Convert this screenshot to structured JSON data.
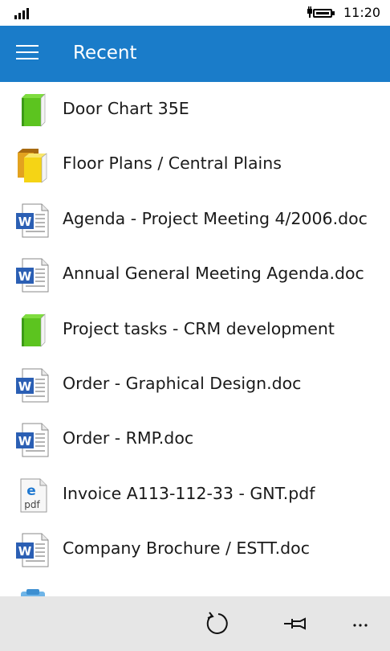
{
  "status": {
    "time": "11:20"
  },
  "header": {
    "title": "Recent"
  },
  "items": [
    {
      "label": "Door Chart 35E",
      "icon": "green-book-icon"
    },
    {
      "label": "Floor Plans / Central Plains",
      "icon": "yellow-books-icon"
    },
    {
      "label": "Agenda - Project Meeting 4/2006.doc",
      "icon": "word-doc-icon"
    },
    {
      "label": "Annual General Meeting Agenda.doc",
      "icon": "word-doc-icon"
    },
    {
      "label": "Project tasks - CRM development",
      "icon": "green-book-icon"
    },
    {
      "label": "Order - Graphical Design.doc",
      "icon": "word-doc-icon"
    },
    {
      "label": "Order - RMP.doc",
      "icon": "word-doc-icon"
    },
    {
      "label": "Invoice A113-112-33 - GNT.pdf",
      "icon": "pdf-icon"
    },
    {
      "label": "Company Brochure / ESTT.doc",
      "icon": "word-doc-icon"
    },
    {
      "label": "",
      "icon": "clipboard-icon"
    }
  ],
  "toolbar": {
    "refresh_icon": "refresh-icon",
    "pin_icon": "pin-icon",
    "more_icon": "more-icon"
  },
  "colors": {
    "accent": "#1a7cc9",
    "bottom_bar": "#e6e6e6"
  }
}
